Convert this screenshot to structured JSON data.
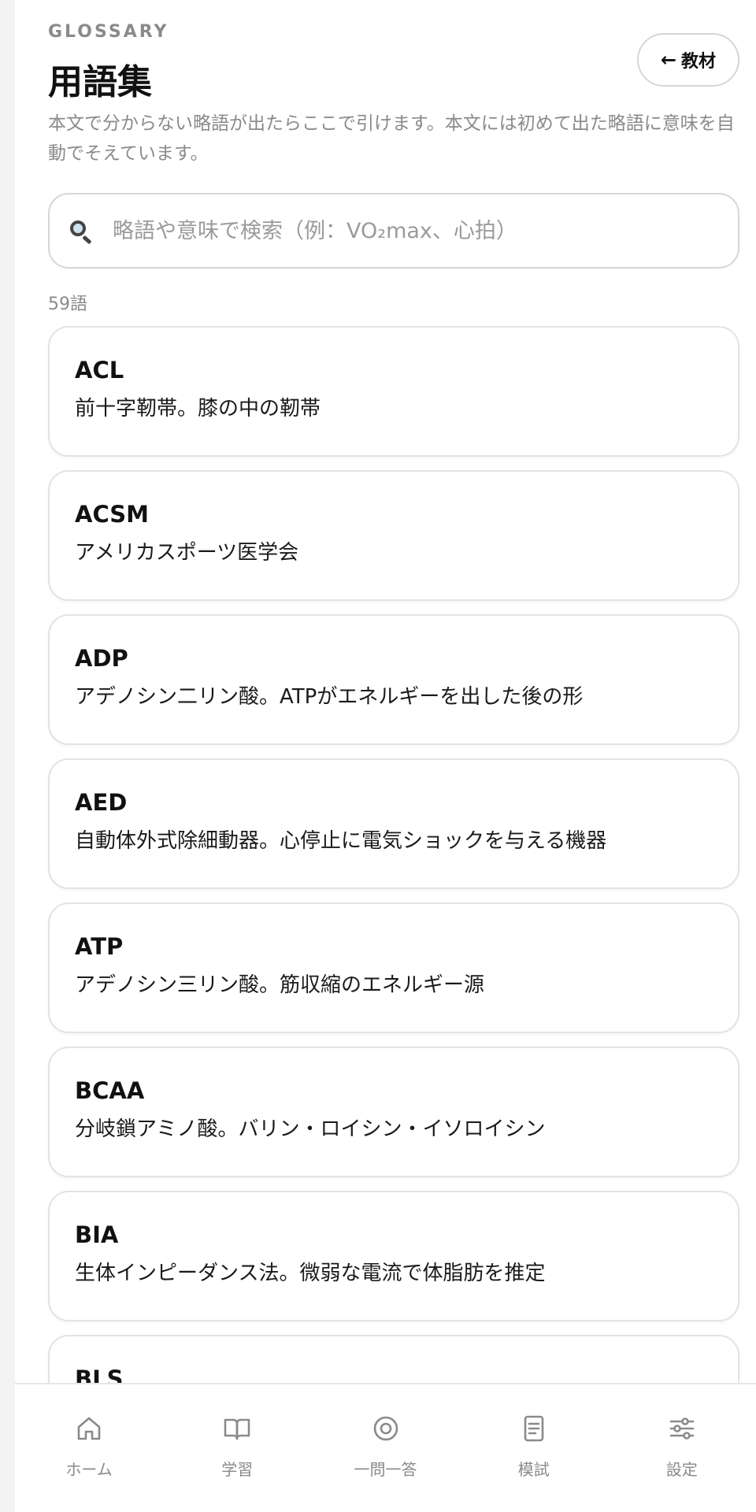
{
  "header": {
    "eyebrow": "GLOSSARY",
    "title": "用語集",
    "back_arrow": "←",
    "back_label": "教材",
    "description": "本文で分からない略語が出たらここで引けます。本文には初めて出た略語に意味を自動でそえています。"
  },
  "search": {
    "placeholder": "略語や意味で検索（例：VO₂max、心拍）",
    "value": ""
  },
  "count_label": "59語",
  "terms": [
    {
      "abbr": "ACL",
      "definition": "前十字靭帯。膝の中の靭帯"
    },
    {
      "abbr": "ACSM",
      "definition": "アメリカスポーツ医学会"
    },
    {
      "abbr": "ADP",
      "definition": "アデノシン二リン酸。ATPがエネルギーを出した後の形"
    },
    {
      "abbr": "AED",
      "definition": "自動体外式除細動器。心停止に電気ショックを与える機器"
    },
    {
      "abbr": "ATP",
      "definition": "アデノシン三リン酸。筋収縮のエネルギー源"
    },
    {
      "abbr": "BCAA",
      "definition": "分岐鎖アミノ酸。バリン・ロイシン・イソロイシン"
    },
    {
      "abbr": "BIA",
      "definition": "生体インピーダンス法。微弱な電流で体脂肪を推定"
    },
    {
      "abbr": "BLS",
      "definition": ""
    }
  ],
  "nav": {
    "items": [
      {
        "label": "ホーム",
        "icon": "home-icon"
      },
      {
        "label": "学習",
        "icon": "book-icon"
      },
      {
        "label": "一問一答",
        "icon": "target-icon"
      },
      {
        "label": "模試",
        "icon": "document-icon"
      },
      {
        "label": "設定",
        "icon": "sliders-icon"
      }
    ]
  }
}
